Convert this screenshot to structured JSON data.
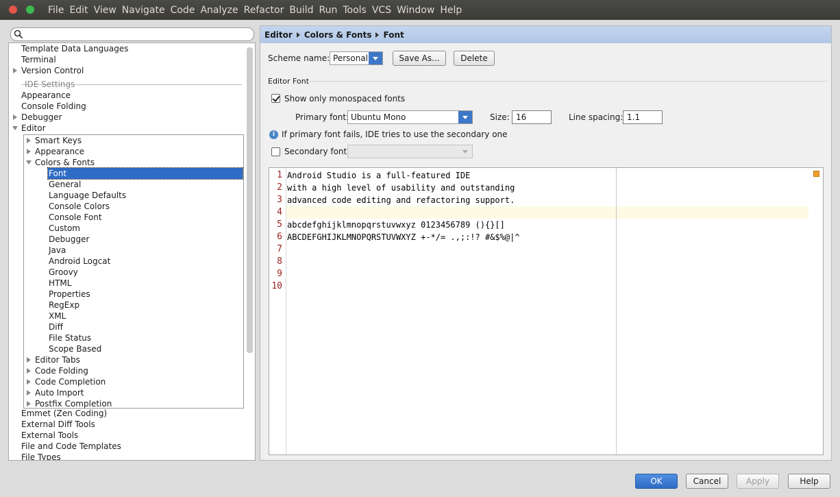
{
  "menubar": {
    "items": [
      "File",
      "Edit",
      "View",
      "Navigate",
      "Code",
      "Analyze",
      "Refactor",
      "Build",
      "Run",
      "Tools",
      "VCS",
      "Window",
      "Help"
    ]
  },
  "search": {
    "placeholder": "",
    "value": ""
  },
  "tree": {
    "top_items": [
      "Template Data Languages",
      "Terminal",
      "Version Control"
    ],
    "separator": "IDE Settings",
    "ide_items": [
      "Appearance",
      "Console Folding",
      "Debugger",
      "Editor"
    ],
    "editor_children": [
      "Smart Keys",
      "Appearance",
      "Colors & Fonts"
    ],
    "colors_fonts_children": [
      "Font",
      "General",
      "Language Defaults",
      "Console Colors",
      "Console Font",
      "Custom",
      "Debugger",
      "Java",
      "Android Logcat",
      "Groovy",
      "HTML",
      "Properties",
      "RegExp",
      "XML",
      "Diff",
      "File Status",
      "Scope Based"
    ],
    "editor_more": [
      "Editor Tabs",
      "Code Folding",
      "Code Completion",
      "Auto Import",
      "Postfix Completion"
    ],
    "bottom_items": [
      "Emmet (Zen Coding)",
      "External Diff Tools",
      "External Tools",
      "File and Code Templates",
      "File Types"
    ]
  },
  "breadcrumb": [
    "Editor",
    "Colors & Fonts",
    "Font"
  ],
  "scheme": {
    "label": "Scheme name:",
    "value": "Personal",
    "save_as": "Save As...",
    "delete": "Delete"
  },
  "editor_font": {
    "group_title": "Editor Font",
    "show_mono_label": "Show only monospaced fonts",
    "show_mono_checked": true,
    "primary_label": "Primary font:",
    "primary_value": "Ubuntu Mono",
    "size_label": "Size:",
    "size_value": "16",
    "spacing_label": "Line spacing:",
    "spacing_value": "1.1",
    "info_text": "If primary font fails, IDE tries to use the secondary one",
    "secondary_label": "Secondary font:",
    "secondary_checked": false,
    "secondary_value": ""
  },
  "preview": {
    "line_numbers": [
      "1",
      "2",
      "3",
      "4",
      "5",
      "6",
      "7",
      "8",
      "9",
      "10"
    ],
    "lines": [
      "Android Studio is a full-featured IDE",
      "with a high level of usability and outstanding",
      "advanced code editing and refactoring support.",
      "",
      "abcdefghijklmnopqrstuvwxyz 0123456789 (){}[]",
      "ABCDEFGHIJKLMNOPQRSTUVWXYZ +-*/= .,;:!? #&$%@|^",
      "",
      "",
      "",
      ""
    ],
    "current_line": 4
  },
  "buttons": {
    "ok": "OK",
    "cancel": "Cancel",
    "apply": "Apply",
    "help": "Help"
  }
}
